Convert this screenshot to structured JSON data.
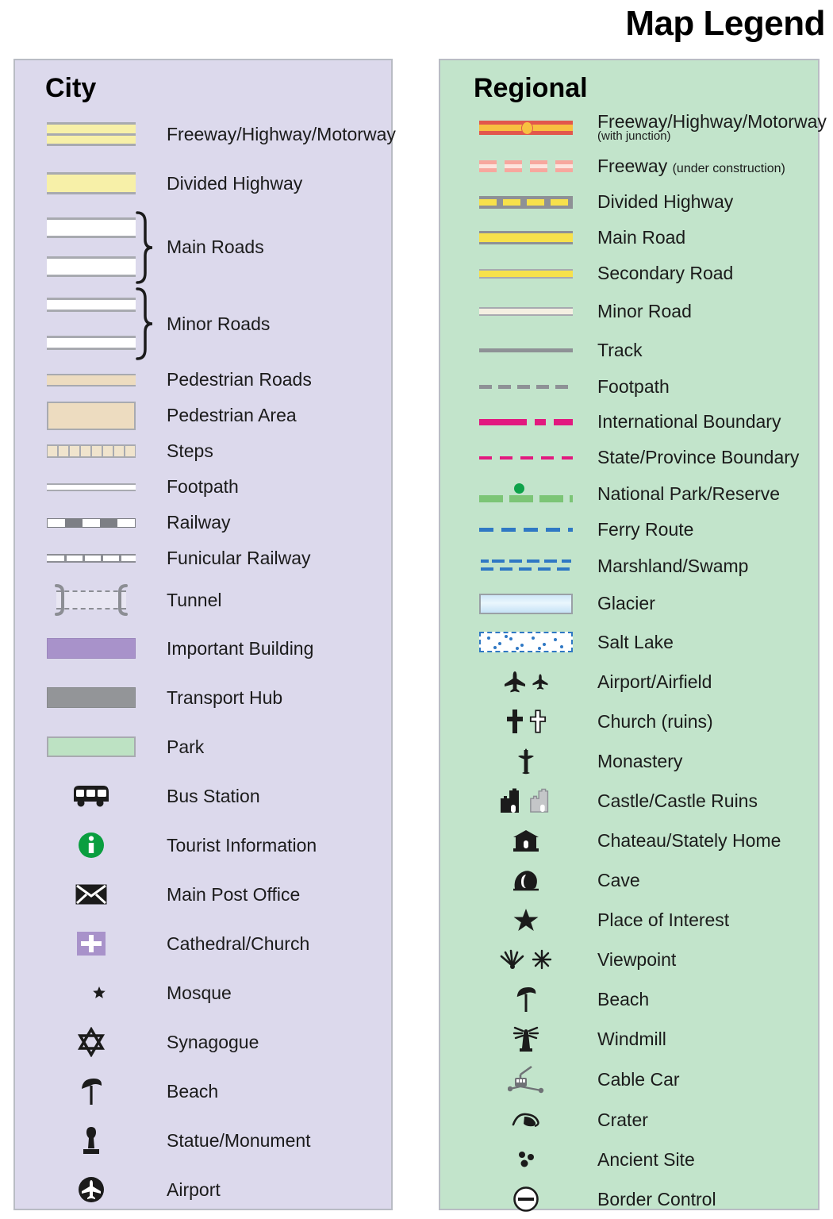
{
  "title": "Map Legend",
  "colors": {
    "city_panel_bg": "#dcd9ec",
    "regional_panel_bg": "#c2e4cb",
    "panel_border": "#b9bcc4",
    "road_yellow": "#f7f0a8",
    "regional_road_yellow": "#f7e14b",
    "freeway_red": "#e2574c",
    "freeway_orange": "#f8c040",
    "pedestrian_tan": "#eddcc0",
    "important_building_purple": "#a892ca",
    "transport_hub_gray": "#939598",
    "park_green": "#bde2c3",
    "boundary_magenta": "#e2197f",
    "national_park_green": "#7cc576",
    "ferry_blue": "#2f78c4",
    "tourist_info_green": "#0a9e3f",
    "text": "#1b1b1b"
  },
  "city": {
    "heading": "City",
    "items": [
      {
        "label": "Freeway/Highway/Motorway",
        "icon": "freeway-swatch"
      },
      {
        "label": "Divided Highway",
        "icon": "divided-highway-swatch"
      },
      {
        "label": "Main Roads",
        "icon": "main-roads-swatch-pair"
      },
      {
        "label": "Minor Roads",
        "icon": "minor-roads-swatch-pair"
      },
      {
        "label": "Pedestrian Roads",
        "icon": "pedestrian-road-swatch"
      },
      {
        "label": "Pedestrian Area",
        "icon": "pedestrian-area-swatch"
      },
      {
        "label": "Steps",
        "icon": "steps-swatch"
      },
      {
        "label": "Footpath",
        "icon": "footpath-swatch"
      },
      {
        "label": "Railway",
        "icon": "railway-swatch"
      },
      {
        "label": "Funicular Railway",
        "icon": "funicular-railway-swatch"
      },
      {
        "label": "Tunnel",
        "icon": "tunnel-swatch"
      },
      {
        "label": "Important Building",
        "icon": "important-building-swatch"
      },
      {
        "label": "Transport Hub",
        "icon": "transport-hub-swatch"
      },
      {
        "label": "Park",
        "icon": "park-swatch"
      },
      {
        "label": "Bus Station",
        "icon": "bus-icon"
      },
      {
        "label": "Tourist Information",
        "icon": "information-icon"
      },
      {
        "label": "Main Post Office",
        "icon": "envelope-icon"
      },
      {
        "label": "Cathedral/Church",
        "icon": "cross-square-icon"
      },
      {
        "label": "Mosque",
        "icon": "star-and-crescent-icon"
      },
      {
        "label": "Synagogue",
        "icon": "star-of-david-icon"
      },
      {
        "label": "Beach",
        "icon": "beach-umbrella-icon"
      },
      {
        "label": "Statue/Monument",
        "icon": "statue-icon"
      },
      {
        "label": "Airport",
        "icon": "airplane-circle-icon"
      }
    ]
  },
  "regional": {
    "heading": "Regional",
    "items": [
      {
        "label": "Freeway/Highway/Motorway",
        "sublabel": "(with junction)",
        "sub_position": "block",
        "icon": "freeway-junction-line"
      },
      {
        "label": "Freeway",
        "sublabel": "(under construction)",
        "sub_position": "inline",
        "icon": "freeway-under-construction-line"
      },
      {
        "label": "Divided Highway",
        "icon": "divided-highway-line"
      },
      {
        "label": "Main Road",
        "icon": "main-road-line"
      },
      {
        "label": "Secondary Road",
        "icon": "secondary-road-line"
      },
      {
        "label": "Minor Road",
        "icon": "minor-road-line"
      },
      {
        "label": "Track",
        "icon": "track-line"
      },
      {
        "label": "Footpath",
        "icon": "footpath-dashed-line"
      },
      {
        "label": "International Boundary",
        "icon": "international-boundary-line"
      },
      {
        "label": "State/Province Boundary",
        "icon": "state-boundary-line"
      },
      {
        "label": "National Park/Reserve",
        "icon": "national-park-line"
      },
      {
        "label": "Ferry Route",
        "icon": "ferry-route-line"
      },
      {
        "label": "Marshland/Swamp",
        "icon": "marshland-pattern"
      },
      {
        "label": "Glacier",
        "icon": "glacier-swatch"
      },
      {
        "label": "Salt Lake",
        "icon": "salt-lake-swatch"
      },
      {
        "label": "Airport/Airfield",
        "icon": "airplane-pair-icon"
      },
      {
        "label": "Church (ruins)",
        "icon": "church-cross-pair-icon"
      },
      {
        "label": "Monastery",
        "icon": "monastery-cross-icon"
      },
      {
        "label": "Castle/Castle Ruins",
        "icon": "castle-pair-icon"
      },
      {
        "label": "Chateau/Stately Home",
        "icon": "chateau-icon"
      },
      {
        "label": "Cave",
        "icon": "cave-icon"
      },
      {
        "label": "Place of Interest",
        "icon": "star-icon"
      },
      {
        "label": "Viewpoint",
        "icon": "viewpoint-pair-icon"
      },
      {
        "label": "Beach",
        "icon": "beach-umbrella-icon"
      },
      {
        "label": "Windmill",
        "icon": "windmill-icon"
      },
      {
        "label": "Cable Car",
        "icon": "cable-car-icon"
      },
      {
        "label": "Crater",
        "icon": "crater-icon"
      },
      {
        "label": "Ancient Site",
        "icon": "ancient-site-icon"
      },
      {
        "label": "Border Control",
        "icon": "border-control-icon"
      }
    ]
  }
}
